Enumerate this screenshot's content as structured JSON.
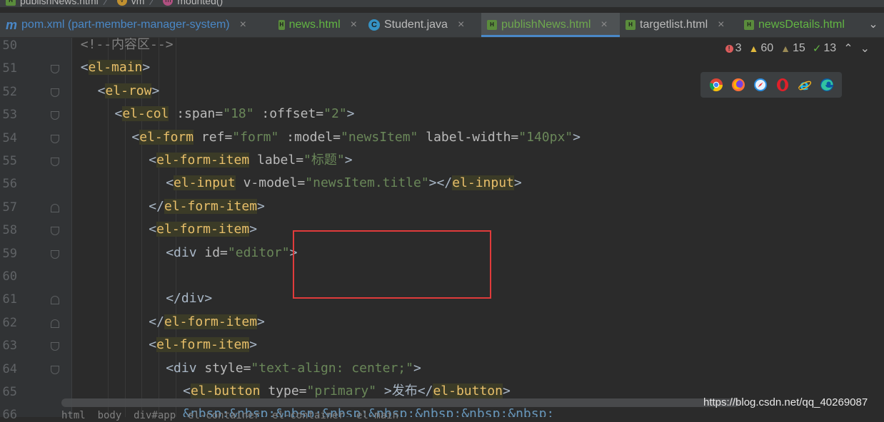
{
  "breadcrumb": {
    "file": "publishNews.html",
    "vm": "vm",
    "method": "mounted()"
  },
  "tabs": [
    {
      "label": "pom.xml (part-member-manager-system)",
      "icon": "maven-icon",
      "color": "#4a88c7"
    },
    {
      "label": "news.html",
      "icon": "html-file-icon",
      "color": "#62b543"
    },
    {
      "label": "Student.java",
      "icon": "java-class-icon",
      "color": "#bbbbbb"
    },
    {
      "label": "publishNews.html",
      "icon": "html-file-icon",
      "color": "#6ea84e",
      "active": true
    },
    {
      "label": "targetlist.html",
      "icon": "html-file-icon",
      "color": "#bbbbbb"
    },
    {
      "label": "newsDetails.html",
      "icon": "html-file-icon",
      "color": "#62b543"
    }
  ],
  "tab_close": "×",
  "tab_more": "⌄",
  "inspections": {
    "errors": "3",
    "warnings": "60",
    "weak_warnings": "15",
    "typos": "13",
    "up": "⌃",
    "down": "⌄"
  },
  "browsers": [
    "chrome-icon",
    "firefox-icon",
    "safari-icon",
    "opera-icon",
    "ie-icon",
    "edge-icon"
  ],
  "lines": [
    {
      "num": "50",
      "text": "<!--内容区-->"
    },
    {
      "num": "51",
      "text": "<el-main>"
    },
    {
      "num": "52",
      "text": "<el-row>"
    },
    {
      "num": "53",
      "text": "<el-col :span=\"18\" :offset=\"2\">"
    },
    {
      "num": "54",
      "text": "<el-form ref=\"form\" :model=\"newsItem\" label-width=\"140px\">"
    },
    {
      "num": "55",
      "text": "<el-form-item label=\"标题\">"
    },
    {
      "num": "56",
      "text": "<el-input v-model=\"newsItem.title\"></el-input>"
    },
    {
      "num": "57",
      "text": "</el-form-item>"
    },
    {
      "num": "58",
      "text": "<el-form-item>"
    },
    {
      "num": "59",
      "text": "<div id=\"editor\">"
    },
    {
      "num": "60",
      "text": ""
    },
    {
      "num": "61",
      "text": "</div>"
    },
    {
      "num": "62",
      "text": "</el-form-item>"
    },
    {
      "num": "63",
      "text": "<el-form-item>"
    },
    {
      "num": "64",
      "text": "<div style=\"text-align: center;\">"
    },
    {
      "num": "65",
      "text": "<el-button type=\"primary\" >发布</el-button>"
    },
    {
      "num": "66",
      "text": "&nbsp;&nbsp;&nbsp;&nbsp;&nbsp;&nbsp;&nbsp;&nbsp;"
    }
  ],
  "bottom_hint": "html  body  div#app  el-container  el-container  el-main",
  "watermark": "https://blog.csdn.net/qq_40269087",
  "colors": {
    "background": "#2b2b2b",
    "gutter": "#313335",
    "tag": "#e8bf6a",
    "attr_value": "#6a8759",
    "highlight_box": "#e03b3b"
  }
}
